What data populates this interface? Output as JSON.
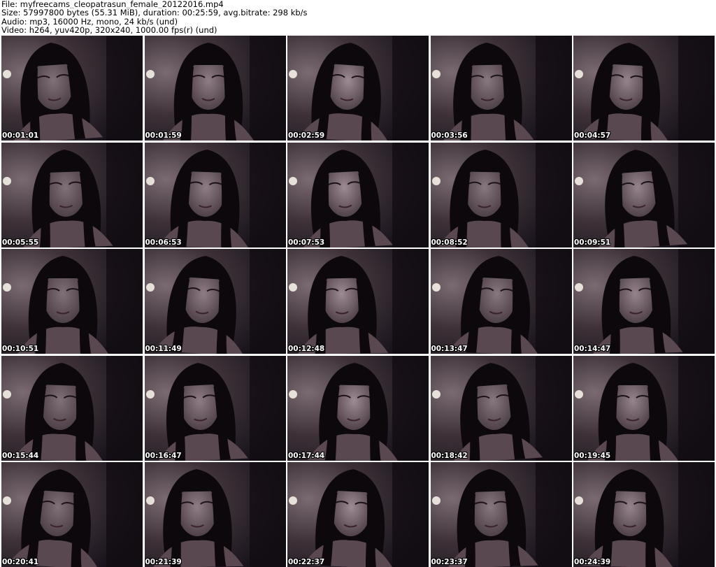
{
  "info": {
    "file": "File: myfreecams_cleopatrasun_female_20122016.mp4",
    "size": "Size: 57997800 bytes (55.31 MiB), duration: 00:25:59, avg.bitrate: 298 kb/s",
    "audio": "Audio: mp3, 16000 Hz, mono, 24 kb/s (und)",
    "video": "Video: h264, yuv420p, 320x240, 1000.00 fps(r) (und)"
  },
  "thumbnails": [
    {
      "timestamp": "00:01:01"
    },
    {
      "timestamp": "00:01:59"
    },
    {
      "timestamp": "00:02:59"
    },
    {
      "timestamp": "00:03:56"
    },
    {
      "timestamp": "00:04:57"
    },
    {
      "timestamp": "00:05:55"
    },
    {
      "timestamp": "00:06:53"
    },
    {
      "timestamp": "00:07:53"
    },
    {
      "timestamp": "00:08:52"
    },
    {
      "timestamp": "00:09:51"
    },
    {
      "timestamp": "00:10:51"
    },
    {
      "timestamp": "00:11:49"
    },
    {
      "timestamp": "00:12:48"
    },
    {
      "timestamp": "00:13:47"
    },
    {
      "timestamp": "00:14:47"
    },
    {
      "timestamp": "00:15:44"
    },
    {
      "timestamp": "00:16:47"
    },
    {
      "timestamp": "00:17:44"
    },
    {
      "timestamp": "00:18:42"
    },
    {
      "timestamp": "00:19:45"
    },
    {
      "timestamp": "00:20:41"
    },
    {
      "timestamp": "00:21:39"
    },
    {
      "timestamp": "00:22:37"
    },
    {
      "timestamp": "00:23:37"
    },
    {
      "timestamp": "00:24:39"
    }
  ]
}
